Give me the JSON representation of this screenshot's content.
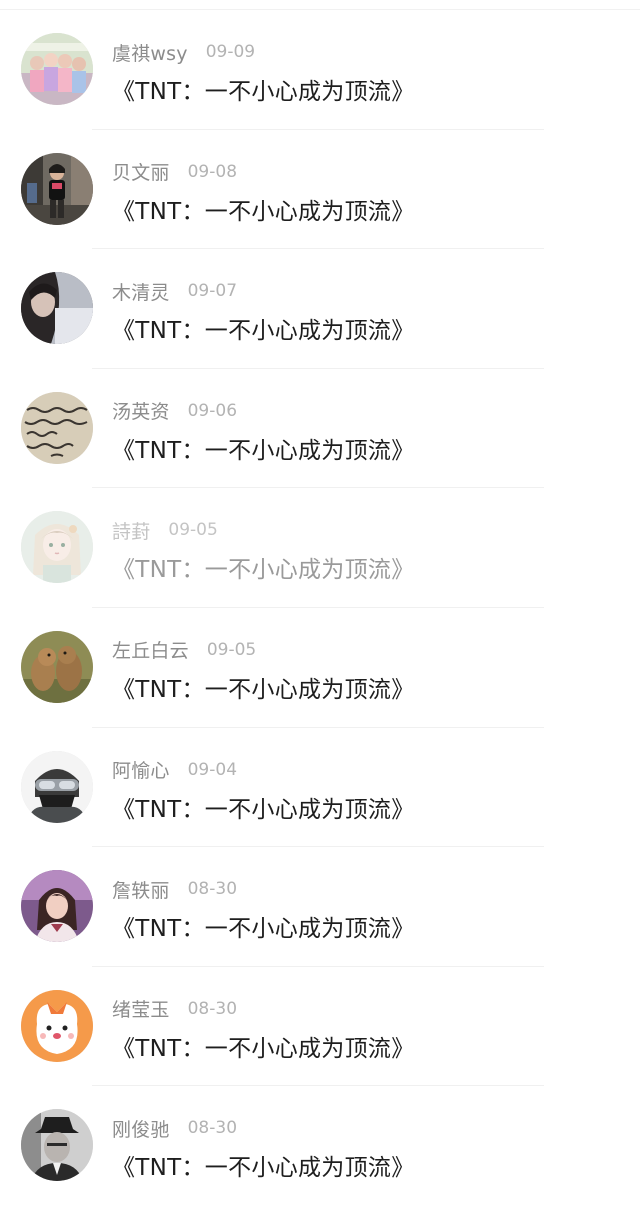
{
  "comments": [
    {
      "user": "虞祺wsy",
      "date": "09-09",
      "text": "《TNT：一不小心成为顶流》",
      "avatar": "group-photo-avatar"
    },
    {
      "user": "贝文丽",
      "date": "09-08",
      "text": "《TNT：一不小心成为顶流》",
      "avatar": "street-photo-avatar"
    },
    {
      "user": "木清灵",
      "date": "09-07",
      "text": "《TNT：一不小心成为顶流》",
      "avatar": "portrait-avatar"
    },
    {
      "user": "汤英资",
      "date": "09-06",
      "text": "《TNT：一不小心成为顶流》",
      "avatar": "handwriting-avatar"
    },
    {
      "user": "詩葑",
      "date": "09-05",
      "text": "《TNT：一不小心成为顶流》",
      "avatar": "anime-girl-avatar"
    },
    {
      "user": "左丘白云",
      "date": "09-05",
      "text": "《TNT：一不小心成为顶流》",
      "avatar": "marmots-avatar"
    },
    {
      "user": "阿愉心",
      "date": "09-04",
      "text": "《TNT：一不小心成为顶流》",
      "avatar": "masked-soldier-avatar"
    },
    {
      "user": "詹轶丽",
      "date": "08-30",
      "text": "《TNT：一不小心成为顶流》",
      "avatar": "girl-portrait-avatar"
    },
    {
      "user": "绪莹玉",
      "date": "08-30",
      "text": "《TNT：一不小心成为顶流》",
      "avatar": "cartoon-dog-avatar"
    },
    {
      "user": "刚俊驰",
      "date": "08-30",
      "text": "《TNT：一不小心成为顶流》",
      "avatar": "hat-man-avatar"
    }
  ]
}
